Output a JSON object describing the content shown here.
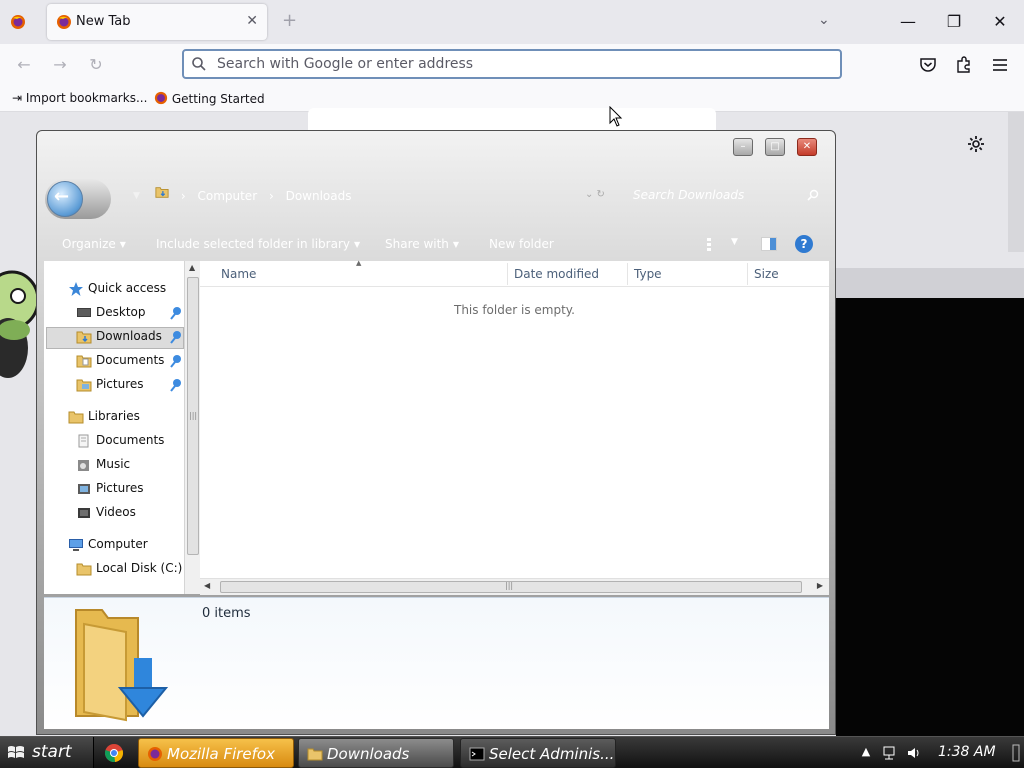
{
  "firefox": {
    "tab_title": "New Tab",
    "tab_close": "✕",
    "new_tab": "+",
    "tab_list": "⌄",
    "minimize": "—",
    "restore": "❐",
    "close": "✕",
    "back": "←",
    "forward": "→",
    "reload": "↻",
    "url_placeholder": "Search with Google or enter address",
    "bookmarks": [
      "Import bookmarks...",
      "Getting Started"
    ],
    "icons": [
      "firefox-icon",
      "search-icon",
      "pocket-icon",
      "extensions-icon",
      "menu-icon",
      "gear-icon"
    ]
  },
  "explorer": {
    "window_buttons": {
      "minimize": "–",
      "maximize": "□",
      "close": "✕"
    },
    "back_arrow": "←",
    "dropdown": "▼",
    "breadcrumb": {
      "sep": "›",
      "items": [
        "Computer",
        "Downloads"
      ]
    },
    "search_placeholder": "Search Downloads",
    "commands": {
      "organize": "Organize",
      "include": "Include selected folder in library",
      "share": "Share with",
      "new_folder": "New folder",
      "caret": "▼",
      "help": "?"
    },
    "nav": {
      "quick_access": "Quick access",
      "quick_items": [
        "Desktop",
        "Downloads",
        "Documents",
        "Pictures"
      ],
      "libraries": "Libraries",
      "library_items": [
        "Documents",
        "Music",
        "Pictures",
        "Videos"
      ],
      "computer": "Computer",
      "computer_items": [
        "Local Disk (C:)"
      ],
      "selected": "Downloads"
    },
    "columns": [
      "Name",
      "Date modified",
      "Type",
      "Size"
    ],
    "sort_arrow": "▲",
    "empty_message": "This folder is empty.",
    "scroll": {
      "up": "▲",
      "left": "◀",
      "right": "▶",
      "grip": "|||"
    },
    "status": "0 items"
  },
  "taskbar": {
    "start": "start",
    "tasks": [
      "Mozilla Firefox",
      "Downloads",
      "Select Adminis..."
    ],
    "tray_arrow": "▲",
    "clock": "1:38 AM"
  }
}
